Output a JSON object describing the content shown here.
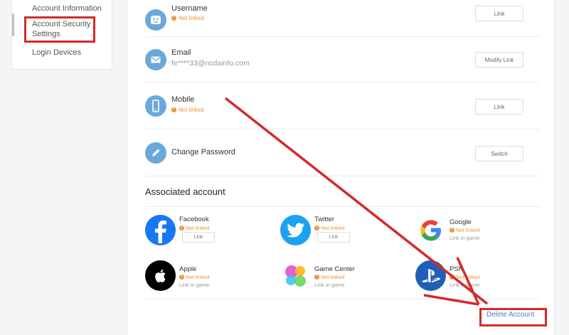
{
  "sidebar": {
    "items": [
      {
        "label": "Account Information"
      },
      {
        "label": "Account Security Settings"
      },
      {
        "label": "Login Devices"
      }
    ]
  },
  "security_rows": [
    {
      "title": "Username",
      "status": "Not linked",
      "button": "Link",
      "icon": "user-face-icon"
    },
    {
      "title": "Email",
      "value": "fe****33@ncdainfo.com",
      "button": "Modify Link",
      "icon": "mail-icon"
    },
    {
      "title": "Mobile",
      "status": "Not linked",
      "button": "Link",
      "icon": "mobile-phone-icon"
    },
    {
      "title": "Change Password",
      "button": "Switch",
      "icon": "pencil-icon"
    }
  ],
  "associated": {
    "title": "Associated account",
    "accounts": [
      {
        "name": "Facebook",
        "status": "Not linked",
        "button": "Link",
        "icon": "facebook-icon",
        "color": "#1877f2"
      },
      {
        "name": "Twitter",
        "status": "Not linked",
        "button": "Link",
        "icon": "twitter-icon",
        "color": "#1da1f2"
      },
      {
        "name": "Google",
        "status": "Not linked",
        "sub": "Link in game",
        "icon": "google-icon"
      },
      {
        "name": "Apple",
        "status": "Not linked",
        "sub": "Link in game",
        "icon": "apple-icon",
        "color": "#000000"
      },
      {
        "name": "Game Center",
        "status": "Not linked",
        "sub": "Link in game",
        "icon": "game-center-icon"
      },
      {
        "name": "PSN",
        "status": "Not linked",
        "sub": "Link in game",
        "icon": "playstation-icon",
        "color": "#1f5fb8"
      }
    ]
  },
  "footer": {
    "delete_label": "Delete Account"
  },
  "colors": {
    "warning": "#e9923a",
    "annotation": "#d42a2a",
    "icon_blue": "#6aa8dc",
    "link": "#4a7bd0"
  }
}
